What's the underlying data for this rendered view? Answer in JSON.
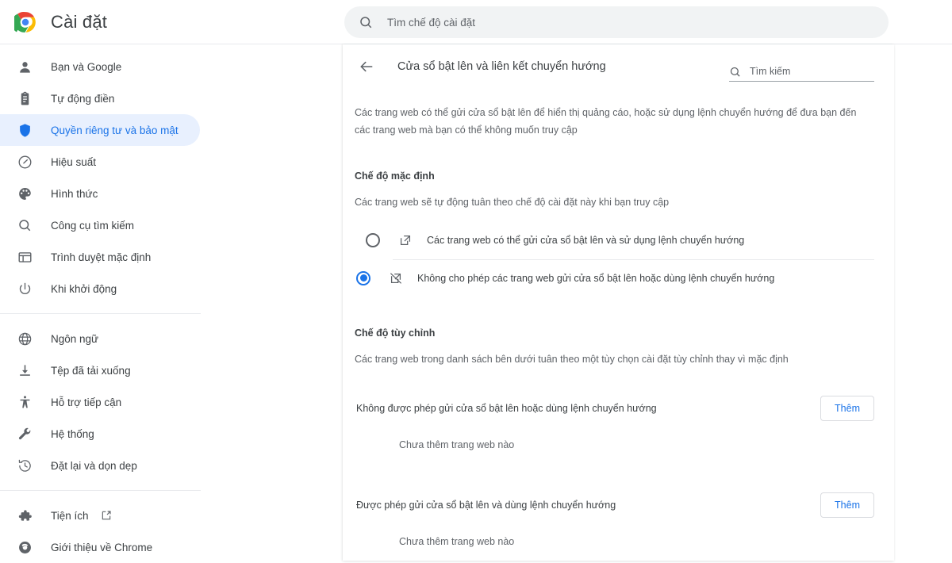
{
  "app": {
    "title": "Cài đặt",
    "logo_icon": "chrome-logo"
  },
  "search": {
    "icon": "search-icon",
    "placeholder": "Tìm chế độ cài đặt",
    "value": ""
  },
  "sidebar": {
    "groups": [
      {
        "items": [
          {
            "label": "Bạn và Google",
            "icon": "person-icon",
            "selected": false
          },
          {
            "label": "Tự động điền",
            "icon": "clipboard-icon",
            "selected": false
          },
          {
            "label": "Quyền riêng tư và bảo mật",
            "icon": "shield-icon",
            "selected": true
          },
          {
            "label": "Hiệu suất",
            "icon": "speedometer-icon",
            "selected": false
          },
          {
            "label": "Hình thức",
            "icon": "palette-icon",
            "selected": false
          },
          {
            "label": "Công cụ tìm kiếm",
            "icon": "search-icon",
            "selected": false
          },
          {
            "label": "Trình duyệt mặc định",
            "icon": "browser-window-icon",
            "selected": false
          },
          {
            "label": "Khi khởi động",
            "icon": "power-icon",
            "selected": false
          }
        ]
      },
      {
        "items": [
          {
            "label": "Ngôn ngữ",
            "icon": "globe-icon",
            "selected": false
          },
          {
            "label": "Tệp đã tải xuống",
            "icon": "download-icon",
            "selected": false
          },
          {
            "label": "Hỗ trợ tiếp cận",
            "icon": "accessibility-icon",
            "selected": false
          },
          {
            "label": "Hệ thống",
            "icon": "wrench-icon",
            "selected": false
          },
          {
            "label": "Đặt lại và dọn dẹp",
            "icon": "history-restore-icon",
            "selected": false
          }
        ]
      },
      {
        "items": [
          {
            "label": "Tiện ích",
            "icon": "puzzle-icon",
            "selected": false,
            "external": true
          },
          {
            "label": "Giới thiệu về Chrome",
            "icon": "chrome-outline-icon",
            "selected": false
          }
        ]
      }
    ]
  },
  "page": {
    "back_icon": "back-arrow-icon",
    "title": "Cửa sổ bật lên và liên kết chuyển hướng",
    "subsearch": {
      "icon": "search-icon",
      "placeholder": "Tìm kiếm",
      "value": ""
    },
    "description": "Các trang web có thể gửi cửa sổ bật lên để hiển thị quảng cáo, hoặc sử dụng lệnh chuyển hướng để đưa bạn đến các trang web mà bạn có thể không muốn truy cập",
    "default_section": {
      "title": "Chế độ mặc định",
      "subtitle": "Các trang web sẽ tự động tuân theo chế độ cài đặt này khi bạn truy cập",
      "options": [
        {
          "label": "Các trang web có thể gửi cửa sổ bật lên và sử dụng lệnh chuyển hướng",
          "icon": "open-in-new-icon",
          "checked": false
        },
        {
          "label": "Không cho phép các trang web gửi cửa sổ bật lên hoặc dùng lệnh chuyển hướng",
          "icon": "open-in-new-off-icon",
          "checked": true
        }
      ]
    },
    "custom_section": {
      "title": "Chế độ tùy chỉnh",
      "subtitle": "Các trang web trong danh sách bên dưới tuân theo một tùy chọn cài đặt tùy chỉnh thay vì mặc định",
      "blocks": [
        {
          "title": "Không được phép gửi cửa sổ bật lên hoặc dùng lệnh chuyển hướng",
          "add_label": "Thêm",
          "empty": "Chưa thêm trang web nào"
        },
        {
          "title": "Được phép gửi cửa sổ bật lên và dùng lệnh chuyển hướng",
          "add_label": "Thêm",
          "empty": "Chưa thêm trang web nào"
        }
      ]
    }
  },
  "colors": {
    "accent": "#1a73e8",
    "selected_bg": "#e8f0fe",
    "text_primary": "#3c4043",
    "text_secondary": "#5f6368",
    "divider": "#e8eaed"
  }
}
